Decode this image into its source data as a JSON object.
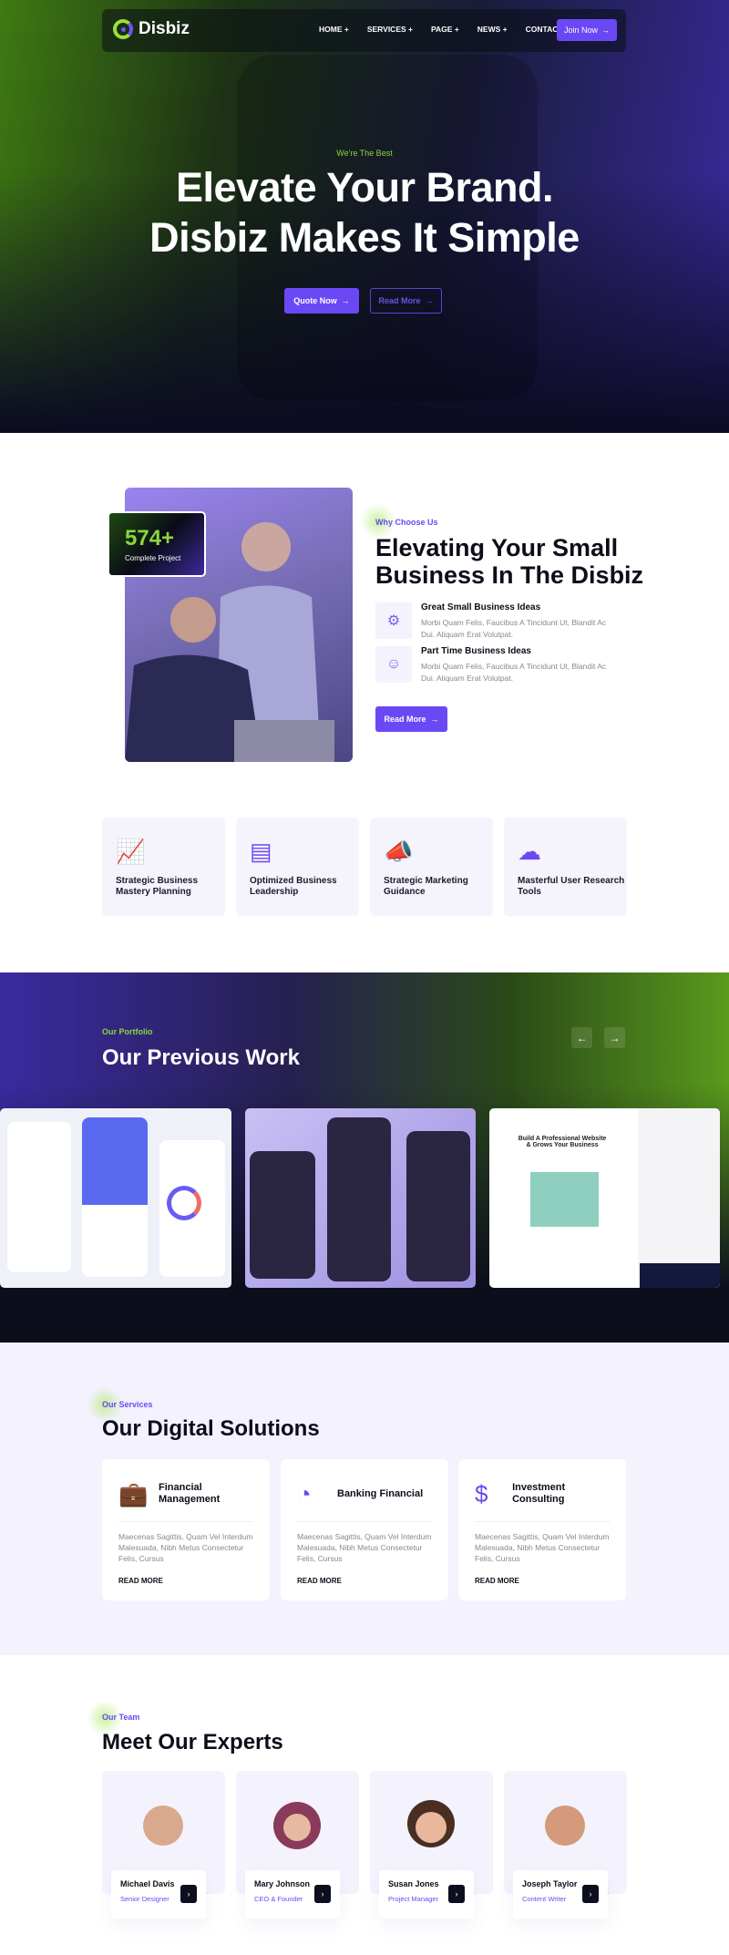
{
  "colors": {
    "primary": "#6b48f5",
    "accent_green": "#8ad63a",
    "dark": "#0d0f1e",
    "light_bg": "#f3f2fd"
  },
  "nav": {
    "brand": "Disbiz",
    "links": [
      "HOME +",
      "SERVICES +",
      "PAGE +",
      "NEWS +",
      "CONTACT"
    ],
    "cta": "Join Now"
  },
  "hero": {
    "eyebrow": "We're The Best",
    "title_line1": "Elevate Your Brand.",
    "title_line2": "Disbiz Makes It Simple",
    "btn_primary": "Quote Now",
    "btn_secondary": "Read More"
  },
  "about": {
    "badge_number": "574+",
    "badge_label": "Complete Project",
    "eyebrow": "Why Choose Us",
    "title_line1": "Elevating Your Small",
    "title_line2": "Business In The Disbiz",
    "items": [
      {
        "title": "Great Small Business Ideas",
        "text": "Morbi Quam Felis, Faucibus A Tincidunt Ut, Blandit Ac Dui. Aliquam Erat Volutpat.",
        "icon": "ideas-icon"
      },
      {
        "title": "Part Time Business Ideas",
        "text": "Morbi Quam Felis, Faucibus A Tincidunt Ut, Blandit Ac Dui. Aliquam Erat Volutpat.",
        "icon": "worker-icon"
      }
    ],
    "button": "Read More"
  },
  "features": [
    {
      "title": "Strategic Business Mastery Planning",
      "icon": "growth-chart-icon"
    },
    {
      "title": "Optimized Business Leadership",
      "icon": "leadership-icon"
    },
    {
      "title": "Strategic Marketing Guidance",
      "icon": "megaphone-icon"
    },
    {
      "title": "Masterful User Research Tools",
      "icon": "cloud-network-icon"
    }
  ],
  "portfolio": {
    "eyebrow": "Our Portfolio",
    "title": "Our Previous Work",
    "cards": [
      {
        "name": "Wallet app UI"
      },
      {
        "name": "Gaming streams app UI"
      },
      {
        "heading_line1": "Build A Professional Website",
        "heading_line2": "& Grows Your Business"
      }
    ]
  },
  "services": {
    "eyebrow": "Our Services",
    "title": "Our Digital Solutions",
    "cards": [
      {
        "title": "Financial Management",
        "icon": "briefcase-icon",
        "text": "Maecenas Sagittis, Quam Vel Interdum Malesuada, Nibh Metus Consectetur Felis, Cursus",
        "link": "READ MORE"
      },
      {
        "title": "Banking Financial",
        "icon": "report-pie-icon",
        "text": "Maecenas Sagittis, Quam Vel Interdum Malesuada, Nibh Metus Consectetur Felis, Cursus",
        "link": "READ MORE"
      },
      {
        "title": "Investment Consulting",
        "icon": "investment-icon",
        "text": "Maecenas Sagittis, Quam Vel Interdum Malesuada, Nibh Metus Consectetur Felis, Cursus",
        "link": "READ MORE"
      }
    ]
  },
  "team": {
    "eyebrow": "Our Team",
    "title": "Meet Our Experts",
    "members": [
      {
        "name": "Michael Davis",
        "role": "Senior Designer"
      },
      {
        "name": "Mary Johnson",
        "role": "CEO & Founder"
      },
      {
        "name": "Susan Jones",
        "role": "Project Manager"
      },
      {
        "name": "Joseph Taylor",
        "role": "Content Writer"
      }
    ]
  }
}
